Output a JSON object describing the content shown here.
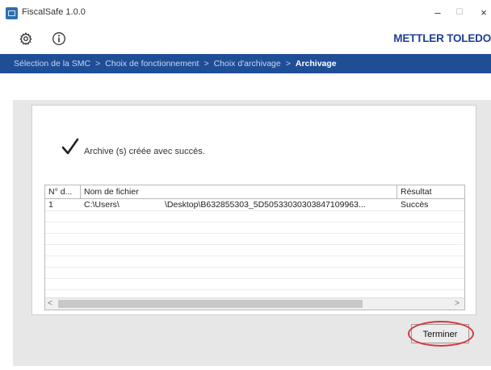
{
  "window": {
    "title": "FiscalSafe 1.0.0",
    "minimize_glyph": "–",
    "maximize_glyph": "☐",
    "close_glyph": "×"
  },
  "toolbar": {
    "settings_icon": "gear-icon",
    "info_icon": "info-icon",
    "brand": "METTLER TOLEDO"
  },
  "breadcrumb": {
    "steps": [
      "Sélection de la SMC",
      "Choix de fonctionnement",
      "Choix d'archivage"
    ],
    "separator": ">",
    "current": "Archivage"
  },
  "result": {
    "message": "Archive (s) créée avec succès."
  },
  "table": {
    "columns": [
      "N° d...",
      "Nom de fichier",
      "Résultat"
    ],
    "rows": [
      {
        "num": "1",
        "file_start": "C:\\Users\\",
        "file_end": "\\Desktop\\B632855303_5D505330303038471099​63...",
        "result": "Succès"
      }
    ],
    "scroll_left": "<",
    "scroll_right": ">"
  },
  "actions": {
    "finish_label": "Terminer"
  },
  "colors": {
    "breadcrumb_bg": "#1f4e97",
    "brand": "#1f3f8f",
    "highlight_ring": "#d63a3a"
  }
}
